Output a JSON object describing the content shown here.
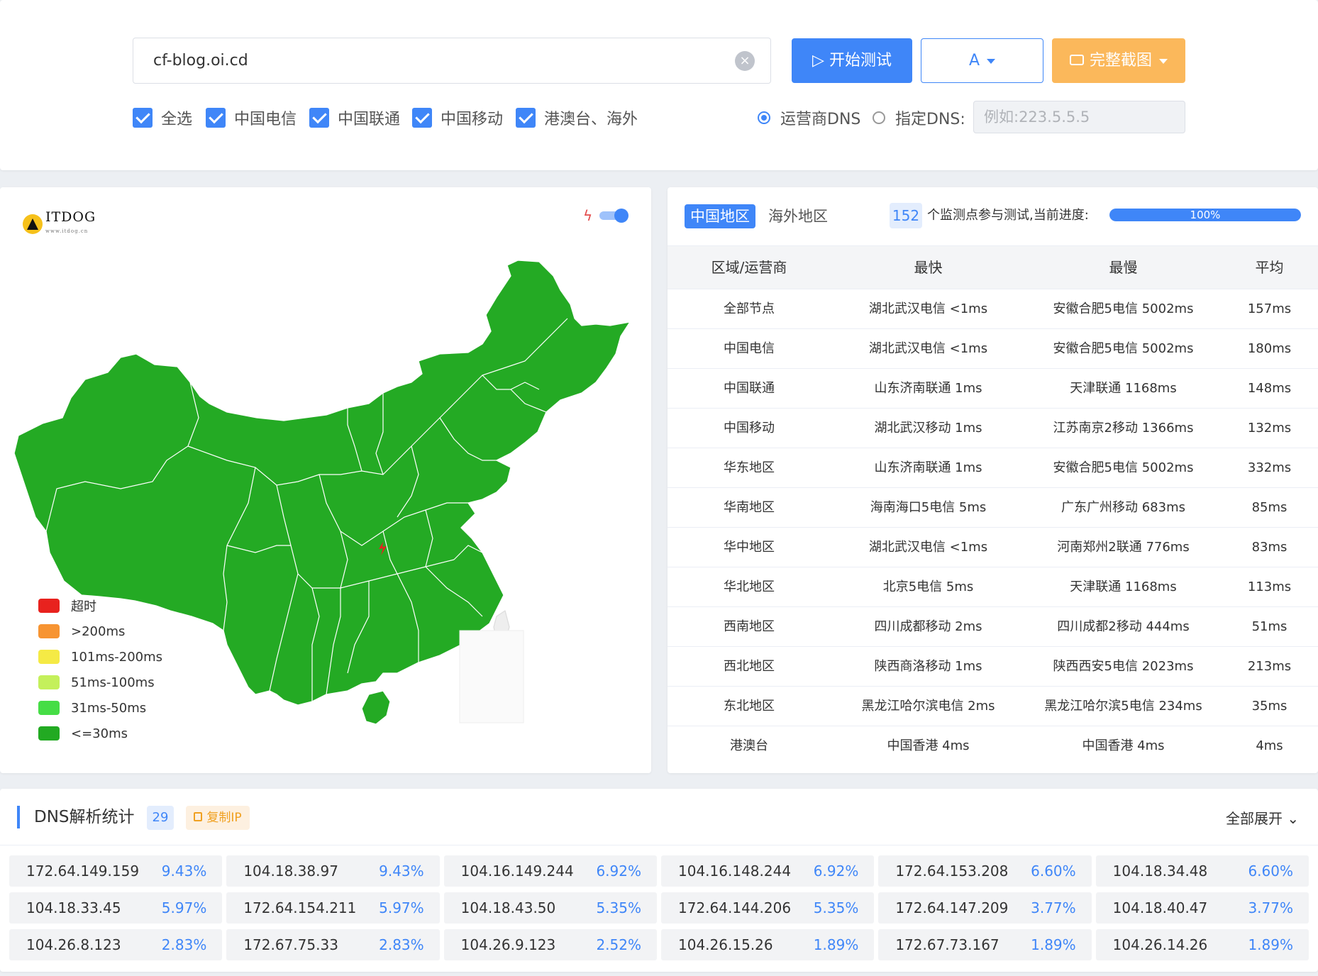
{
  "search": {
    "domain": "cf-blog.oi.cd",
    "clear_icon": "×",
    "start_label": "开始测试",
    "record_type": "A",
    "screenshot_label": "完整截图"
  },
  "filters": {
    "select_all": "全选",
    "telecom": "中国电信",
    "unicom": "中国联通",
    "mobile": "中国移动",
    "overseas": "港澳台、海外"
  },
  "dns_mode": {
    "isp_dns": "运营商DNS",
    "custom_dns": "指定DNS:",
    "custom_placeholder": "例如:223.5.5.5"
  },
  "map": {
    "logo_text": "ITDOG",
    "logo_sub": "www.itdog.cn",
    "legend": [
      {
        "label": "超时",
        "color": "#e8221e"
      },
      {
        "label": ">200ms",
        "color": "#f79432"
      },
      {
        "label": "101ms-200ms",
        "color": "#f5ea45"
      },
      {
        "label": "51ms-100ms",
        "color": "#c4f05b"
      },
      {
        "label": "31ms-50ms",
        "color": "#46dd46"
      },
      {
        "label": "<=30ms",
        "color": "#22aa22"
      }
    ],
    "fill_color": "#24aa24"
  },
  "results": {
    "tab_cn": "中国地区",
    "tab_intl": "海外地区",
    "node_count": "152",
    "progress_text": "个监测点参与测试,当前进度:",
    "progress_label": "100%",
    "progress_value": 100,
    "headers": {
      "region": "区域/运营商",
      "fastest": "最快",
      "slowest": "最慢",
      "average": "平均"
    },
    "rows": [
      {
        "region": "全部节点",
        "fastest": "湖北武汉电信 <1ms",
        "slowest": "安徽合肥5电信 5002ms",
        "average": "157ms"
      },
      {
        "region": "中国电信",
        "fastest": "湖北武汉电信 <1ms",
        "slowest": "安徽合肥5电信 5002ms",
        "average": "180ms"
      },
      {
        "region": "中国联通",
        "fastest": "山东济南联通 1ms",
        "slowest": "天津联通 1168ms",
        "average": "148ms"
      },
      {
        "region": "中国移动",
        "fastest": "湖北武汉移动 1ms",
        "slowest": "江苏南京2移动 1366ms",
        "average": "132ms"
      },
      {
        "region": "华东地区",
        "fastest": "山东济南联通 1ms",
        "slowest": "安徽合肥5电信 5002ms",
        "average": "332ms"
      },
      {
        "region": "华南地区",
        "fastest": "海南海口5电信 5ms",
        "slowest": "广东广州移动 683ms",
        "average": "85ms"
      },
      {
        "region": "华中地区",
        "fastest": "湖北武汉电信 <1ms",
        "slowest": "河南郑州2联通 776ms",
        "average": "83ms"
      },
      {
        "region": "华北地区",
        "fastest": "北京5电信 5ms",
        "slowest": "天津联通 1168ms",
        "average": "113ms"
      },
      {
        "region": "西南地区",
        "fastest": "四川成都移动 2ms",
        "slowest": "四川成都2移动 444ms",
        "average": "51ms"
      },
      {
        "region": "西北地区",
        "fastest": "陕西商洛移动 1ms",
        "slowest": "陕西西安5电信 2023ms",
        "average": "213ms"
      },
      {
        "region": "东北地区",
        "fastest": "黑龙江哈尔滨电信 2ms",
        "slowest": "黑龙江哈尔滨5电信 234ms",
        "average": "35ms"
      },
      {
        "region": "港澳台",
        "fastest": "中国香港 4ms",
        "slowest": "中国香港 4ms",
        "average": "4ms"
      }
    ]
  },
  "dns_stats": {
    "title": "DNS解析统计",
    "count": "29",
    "copy_label": "复制IP",
    "expand_label": "全部展开",
    "ips": [
      {
        "ip": "172.64.149.159",
        "pct": "9.43%"
      },
      {
        "ip": "104.18.38.97",
        "pct": "9.43%"
      },
      {
        "ip": "104.16.149.244",
        "pct": "6.92%"
      },
      {
        "ip": "104.16.148.244",
        "pct": "6.92%"
      },
      {
        "ip": "172.64.153.208",
        "pct": "6.60%"
      },
      {
        "ip": "104.18.34.48",
        "pct": "6.60%"
      },
      {
        "ip": "104.18.33.45",
        "pct": "5.97%"
      },
      {
        "ip": "172.64.154.211",
        "pct": "5.97%"
      },
      {
        "ip": "104.18.43.50",
        "pct": "5.35%"
      },
      {
        "ip": "172.64.144.206",
        "pct": "5.35%"
      },
      {
        "ip": "172.64.147.209",
        "pct": "3.77%"
      },
      {
        "ip": "104.18.40.47",
        "pct": "3.77%"
      },
      {
        "ip": "104.26.8.123",
        "pct": "2.83%"
      },
      {
        "ip": "172.67.75.33",
        "pct": "2.83%"
      },
      {
        "ip": "104.26.9.123",
        "pct": "2.52%"
      },
      {
        "ip": "104.26.15.26",
        "pct": "1.89%"
      },
      {
        "ip": "172.67.73.167",
        "pct": "1.89%"
      },
      {
        "ip": "104.26.14.26",
        "pct": "1.89%"
      }
    ]
  }
}
